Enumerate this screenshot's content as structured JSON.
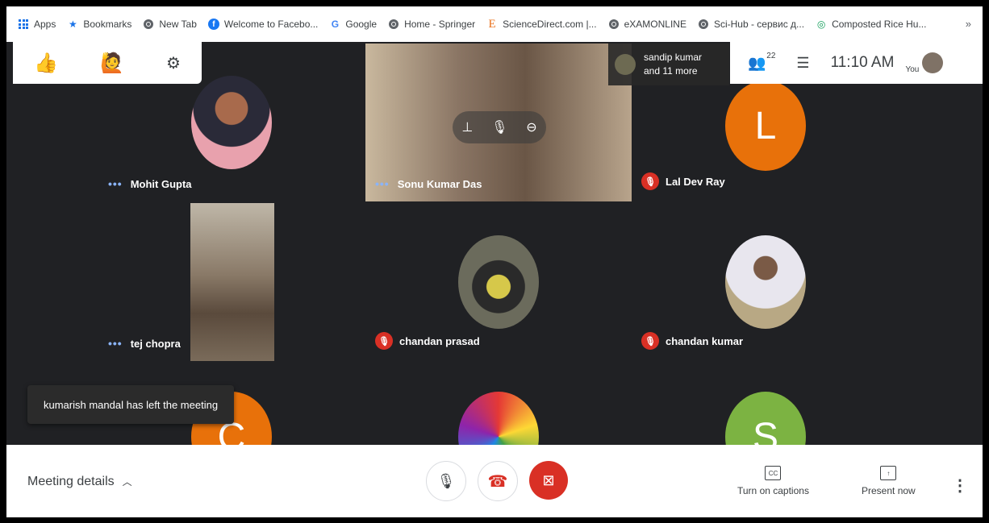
{
  "bookmarks": [
    {
      "label": "Apps",
      "icon": "apps-grid-icon"
    },
    {
      "label": "Bookmarks",
      "icon": "star-icon"
    },
    {
      "label": "New Tab",
      "icon": "globe-icon"
    },
    {
      "label": "Welcome to Facebo...",
      "icon": "facebook-icon"
    },
    {
      "label": "Google",
      "icon": "google-icon"
    },
    {
      "label": "Home - Springer",
      "icon": "globe-icon"
    },
    {
      "label": "ScienceDirect.com |...",
      "icon": "elsevier-icon"
    },
    {
      "label": "eXAMONLINE",
      "icon": "globe-icon"
    },
    {
      "label": "Sci-Hub - сервис д...",
      "icon": "globe-icon"
    },
    {
      "label": "Composted Rice Hu...",
      "icon": "link-icon"
    }
  ],
  "bookmarks_more": "»",
  "toolbar": {
    "clock": "11:10 AM",
    "participants_count": "22",
    "you_label": "You"
  },
  "presenter": {
    "line1": "sandip kumar",
    "line2": "and 11 more"
  },
  "participants": [
    {
      "name": "Mohit Gupta",
      "muted": false
    },
    {
      "name": "Sonu Kumar Das",
      "muted": false
    },
    {
      "name": "Lal Dev Ray",
      "muted": true,
      "initial": "L",
      "color": "#e8710a"
    },
    {
      "name": "tej chopra",
      "muted": false
    },
    {
      "name": "chandan prasad",
      "muted": true
    },
    {
      "name": "chandan kumar",
      "muted": true
    },
    {
      "initial": "C",
      "color": "#e8710a"
    },
    {
      "initial": "S",
      "color": "#7cb342"
    }
  ],
  "toast": "kumarish mandal has left the meeting",
  "bottom": {
    "meeting_details": "Meeting details",
    "captions": "Turn on captions",
    "present": "Present now"
  }
}
